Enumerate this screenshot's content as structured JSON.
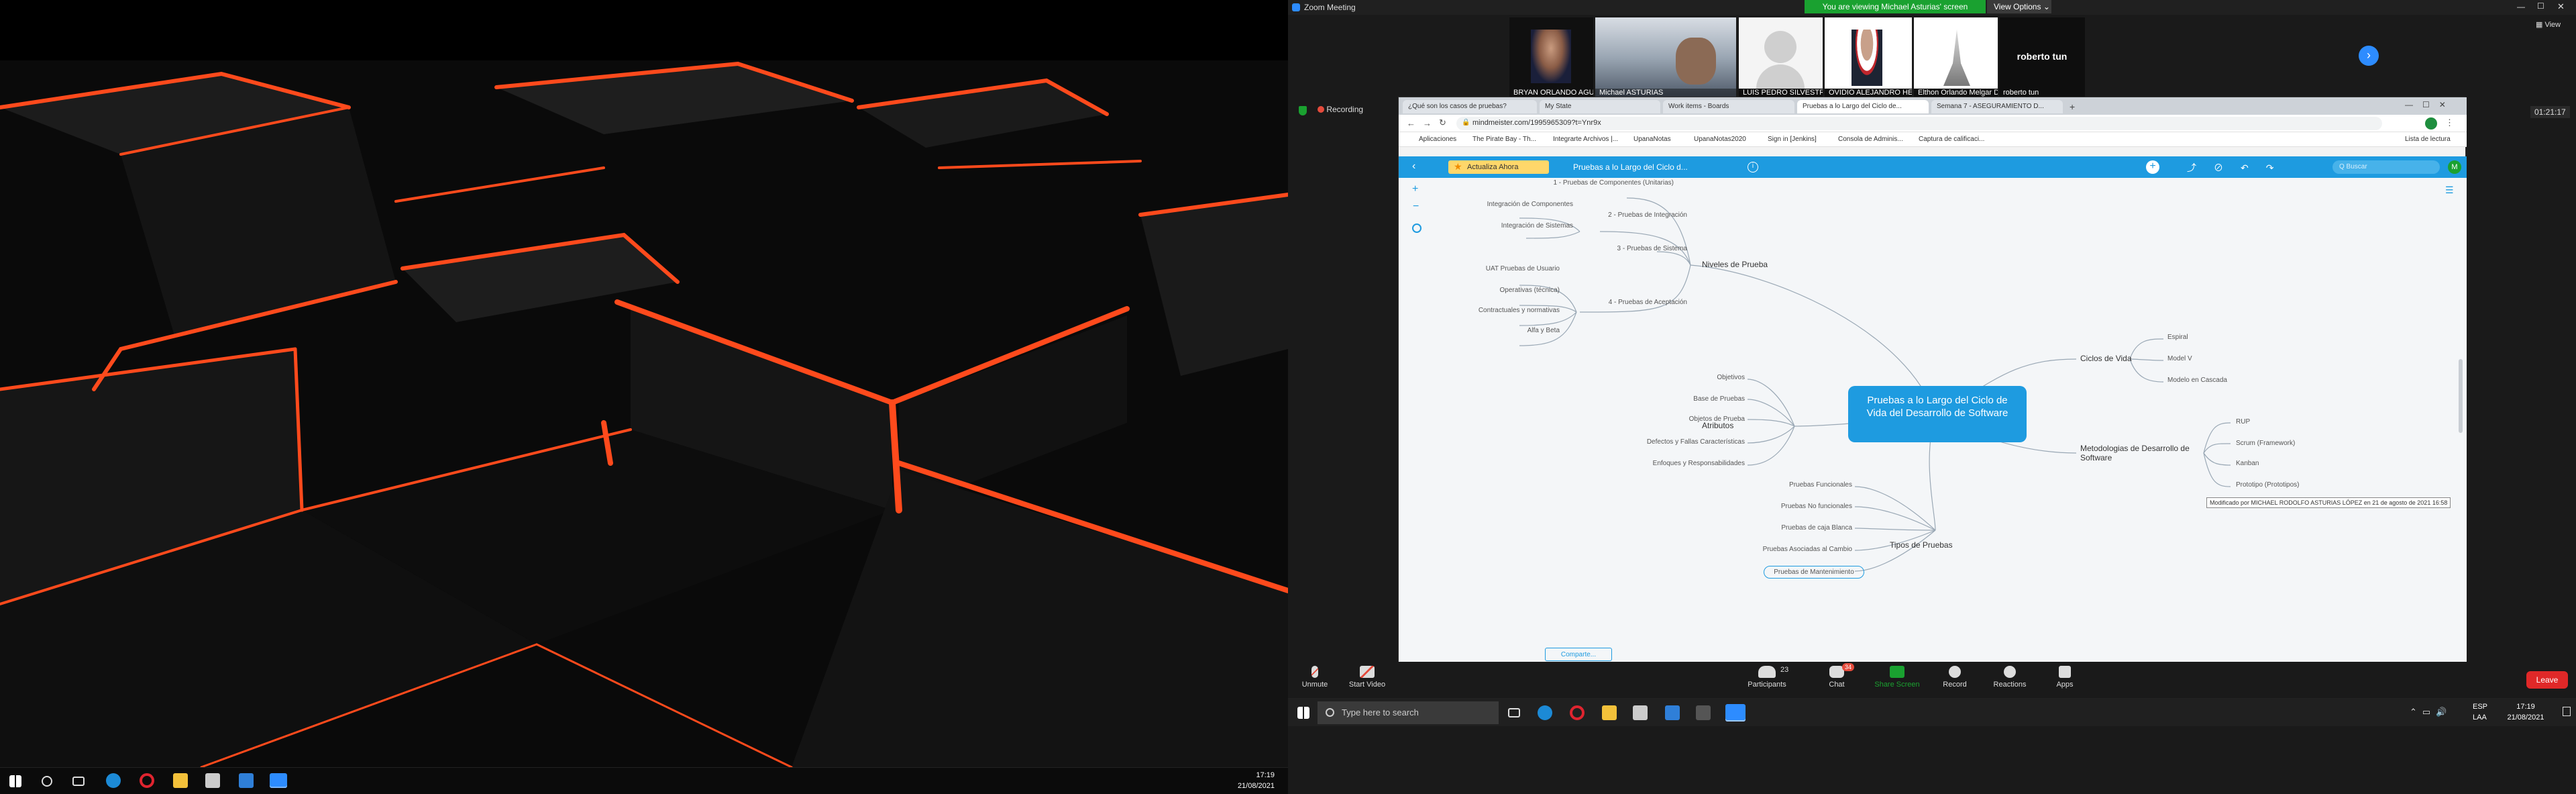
{
  "left_screen": {
    "taskbar": {
      "time": "17:19",
      "date": "21/08/2021"
    }
  },
  "zoom": {
    "window_title": "Zoom Meeting",
    "viewing_banner": "You are viewing Michael Asturias' screen",
    "view_options": "View Options",
    "view_label": "View",
    "recording": "Recording",
    "timer": "01:21:17",
    "participants_tiles": [
      {
        "name": "BRYAN ORLANDO AGUIRRE S..."
      },
      {
        "name": "Michael ASTURIAS"
      },
      {
        "name": "LUIS PEDRO SILVESTRE CRUZ"
      },
      {
        "name": "OVIDIO ALEJANDRO HERNAN..."
      },
      {
        "name": "Elthon Orlando Melgar De Le..."
      },
      {
        "name": "roberto tun",
        "big_name": "roberto tun"
      }
    ],
    "toolbar": {
      "unmute": "Unmute",
      "start_video": "Start Video",
      "participants": "Participants",
      "participants_count": "23",
      "chat": "Chat",
      "chat_badge": "34",
      "share_screen": "Share Screen",
      "record": "Record",
      "reactions": "Reactions",
      "apps": "Apps",
      "leave": "Leave"
    }
  },
  "browser": {
    "tabs": [
      "¿Qué son los casos de pruebas?",
      "My State",
      "Work items - Boards",
      "Pruebas a lo Largo del Ciclo de...",
      "Semana 7 - ASEGURAMIENTO D..."
    ],
    "url": "mindmeister.com/1995965309?t=Ynr9x",
    "bookmarks": [
      "Aplicaciones",
      "The Pirate Bay - Th...",
      "Integrarte Archivos |...",
      "UpanaNotas",
      "UpanaNotas2020",
      "Sign in [Jenkins]",
      "Consola de Adminis...",
      "Captura de calificaci..."
    ],
    "reading_list": "Lista de lectura"
  },
  "mindmeister": {
    "top_button": "Actualiza Ahora",
    "map_title": "Pruebas a lo Largo del Ciclo d...",
    "search_placeholder": "Q Buscar",
    "avatar": "M",
    "root": "Pruebas a lo Largo del Ciclo de Vida del Desarrollo de Software",
    "niveles": {
      "title": "Niveles de Prueba",
      "items": [
        "1 - Pruebas de Componentes (Unitarias)",
        "2 - Pruebas de Integración",
        "3 - Pruebas de Sistema",
        "4 - Pruebas de Aceptación"
      ],
      "integracion": [
        "Integración de Componentes",
        "Integración de Sistemas"
      ],
      "aceptacion": [
        "UAT Pruebas de Usuario",
        "Operativas (técnica)",
        "Contractuales y normativas",
        "Alfa y Beta"
      ]
    },
    "atributos": {
      "title": "Atributos",
      "items": [
        "Objetivos",
        "Base de Pruebas",
        "Objetos de Prueba",
        "Defectos y Fallas Características",
        "Enfoques y Responsabilidades"
      ]
    },
    "tipos": {
      "title": "Tipos de Pruebas",
      "items": [
        "Pruebas Funcionales",
        "Pruebas No funcionales",
        "Pruebas de caja Blanca",
        "Pruebas Asociadas al Cambio",
        "Pruebas de Mantenimiento"
      ]
    },
    "ciclos": {
      "title": "Ciclos de Vida",
      "items": [
        "Espiral",
        "Model V",
        "Modelo en Cascada"
      ]
    },
    "metodologias": {
      "title": "Metodologias de Desarrollo de Software",
      "items": [
        "RUP",
        "Scrum (Framework)",
        "Kanban",
        "Prototipo (Prototipos)"
      ]
    },
    "tooltip": "Modificado por MICHAEL RODOLFO ASTURIAS LÓPEZ en 21 de agosto de 2021 16:58",
    "bottom_button": "Comparte..."
  },
  "right_taskbar": {
    "search_placeholder": "Type here to search",
    "lang1": "ESP",
    "lang2": "LAA",
    "time": "17:19",
    "date": "21/08/2021"
  }
}
